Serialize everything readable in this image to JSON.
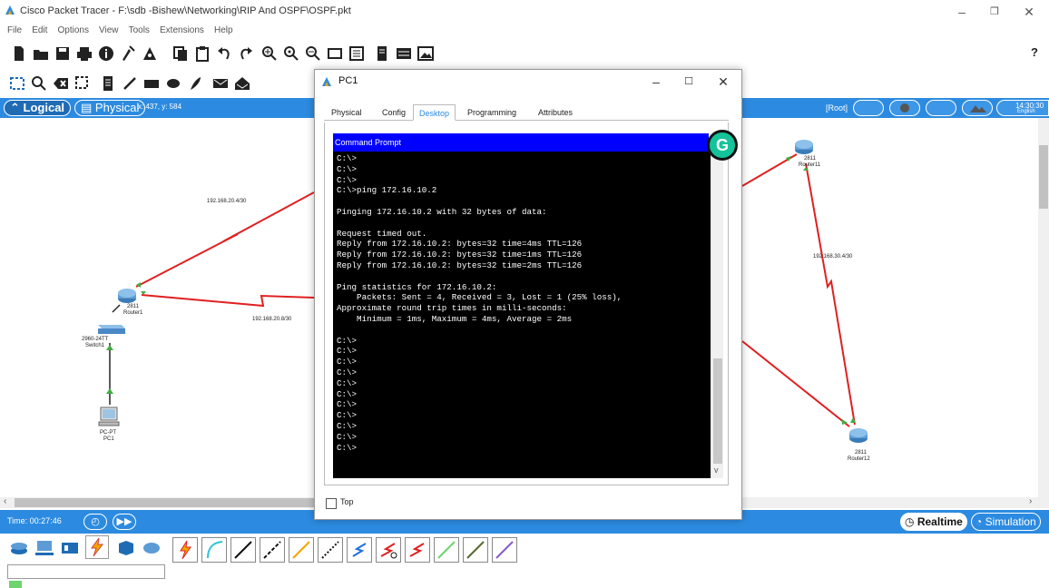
{
  "window": {
    "title": "Cisco Packet Tracer - F:\\sdb -Bishew\\Networking\\RIP And OSPF\\OSPF.pkt",
    "help_label": "?"
  },
  "menu": [
    "File",
    "Edit",
    "Options",
    "View",
    "Tools",
    "Extensions",
    "Help"
  ],
  "workspace": {
    "logical_label": "Logical",
    "physical_label": "Physical",
    "coords": "x: 437, y: 584",
    "root_label": "[Root]",
    "clock": "14:30:30",
    "language": "English"
  },
  "network": {
    "links": {
      "link1": "192.168.20.4/30",
      "link2": "192.168.20.8/30",
      "link3": "192.168.30.4/30"
    },
    "devices": {
      "router1_model": "2811",
      "router1_name": "Router1",
      "switch1_model": "2960-24TT",
      "switch1_name": "Switch1",
      "pc1_model": "PC-PT",
      "pc1_name": "PC1",
      "router11_model": "2811",
      "router11_name": "Router11",
      "router12_model": "2811",
      "router12_name": "Router12"
    }
  },
  "bottom": {
    "time_label": "Time: 00:27:46",
    "realtime_label": "Realtime",
    "simulation_label": "Simulation"
  },
  "dialog": {
    "title": "PC1",
    "tabs": [
      "Physical",
      "Config",
      "Desktop",
      "Programming",
      "Attributes"
    ],
    "active_tab": "Desktop",
    "command_prompt_title": "Command Prompt",
    "top_label": "Top",
    "grammarly_badge": "G",
    "terminal_text": "C:\\>\nC:\\>\nC:\\>\nC:\\>ping 172.16.10.2\n\nPinging 172.16.10.2 with 32 bytes of data:\n\nRequest timed out.\nReply from 172.16.10.2: bytes=32 time=4ms TTL=126\nReply from 172.16.10.2: bytes=32 time=1ms TTL=126\nReply from 172.16.10.2: bytes=32 time=2ms TTL=126\n\nPing statistics for 172.16.10.2:\n    Packets: Sent = 4, Received = 3, Lost = 1 (25% loss),\nApproximate round trip times in milli-seconds:\n    Minimum = 1ms, Maximum = 4ms, Average = 2ms\n\nC:\\>\nC:\\>\nC:\\>\nC:\\>\nC:\\>\nC:\\>\nC:\\>\nC:\\>\nC:\\>\nC:\\>\nC:\\>"
  },
  "colors": {
    "accent_blue": "#2c8be0",
    "link_red": "#e02020",
    "cmd_header": "#0000ff"
  }
}
